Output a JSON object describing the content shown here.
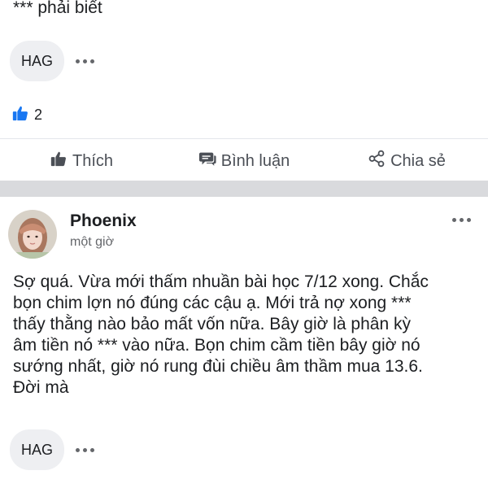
{
  "previous_post": {
    "tail_text": "*** phải biết",
    "tag_label": "HAG",
    "like_count": "2",
    "actions": {
      "like": "Thích",
      "comment": "Bình luận",
      "share": "Chia sẻ"
    }
  },
  "post": {
    "author": "Phoenix",
    "time": "một giờ",
    "content": "Sợ quá. Vừa mới thấm nhuần bài học 7/12 xong. Chắc\nbọn chim lợn nó đúng các cậu ạ. Mới trả nợ xong ***\nthấy thằng nào bảo mất vốn nữa. Bây giờ là phân kỳ\nâm tiền nó *** vào nữa. Bọn chim cầm tiền bây giờ nó\nsướng nhất, giờ nó rung đùi chiều âm thầm mua 13.6.\nĐời mà",
    "tag_label": "HAG"
  },
  "colors": {
    "like_blue": "#1877f2",
    "separator": "#d9dadd",
    "muted_text": "#65676b"
  }
}
